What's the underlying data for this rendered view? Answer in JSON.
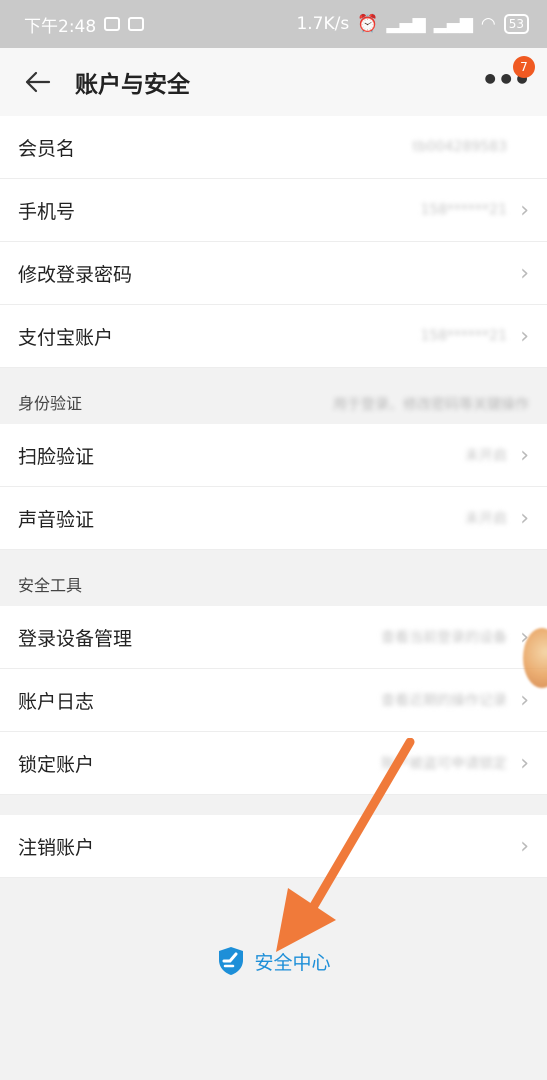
{
  "status_bar": {
    "time": "下午2:48",
    "speed": "1.7K/s",
    "battery": "53"
  },
  "header": {
    "title": "账户与安全",
    "badge_count": "7"
  },
  "group1": [
    {
      "label": "会员名",
      "value": "tb004289583",
      "chevron": false
    },
    {
      "label": "手机号",
      "value": "158******21",
      "chevron": true
    },
    {
      "label": "修改登录密码",
      "value": "",
      "chevron": true
    },
    {
      "label": "支付宝账户",
      "value": "158******21",
      "chevron": true
    }
  ],
  "section_identity": {
    "title": "身份验证",
    "note": "用于登录、修改密码等关键操作"
  },
  "group2": [
    {
      "label": "扫脸验证",
      "value": "未开启",
      "chevron": true
    },
    {
      "label": "声音验证",
      "value": "未开启",
      "chevron": true
    }
  ],
  "section_tools": {
    "title": "安全工具"
  },
  "group3": [
    {
      "label": "登录设备管理",
      "value": "查看当前登录的设备",
      "chevron": true
    },
    {
      "label": "账户日志",
      "value": "查看近期的操作记录",
      "chevron": true
    },
    {
      "label": "锁定账户",
      "value": "账户被盗可申请锁定",
      "chevron": true
    }
  ],
  "group4": [
    {
      "label": "注销账户",
      "value": "",
      "chevron": true
    }
  ],
  "footer": {
    "text": "安全中心"
  },
  "colors": {
    "accent": "#1d8fd8",
    "badge": "#f05a22",
    "arrow": "#f07a3a"
  },
  "icons": {
    "back": "arrow-left-icon",
    "more": "more-dots-icon",
    "chevron": "chevron-right-icon",
    "footer": "shield-icon"
  }
}
